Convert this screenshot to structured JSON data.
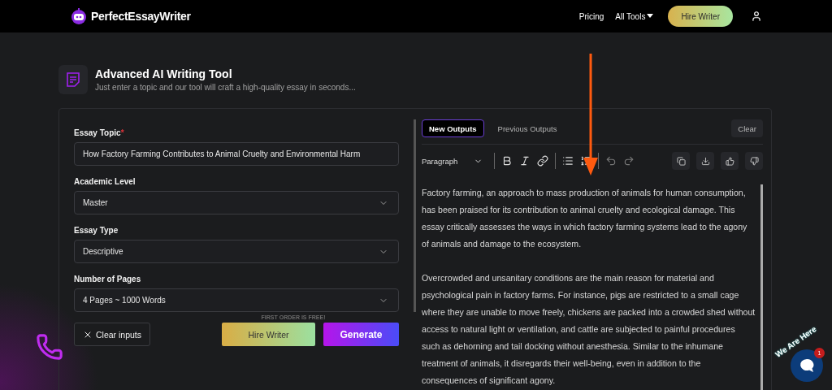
{
  "header": {
    "logo_text": "PerfectEssayWriter",
    "nav": [
      {
        "label": "Pricing",
        "kind": "link"
      },
      {
        "label": "All Tools",
        "kind": "dropdown"
      }
    ],
    "hire_button": "Hire Writer"
  },
  "tool": {
    "title": "Advanced AI Writing Tool",
    "subtitle": "Just enter a topic and our tool will craft a high-quality essay in seconds..."
  },
  "form": {
    "required_marker": "*",
    "fields": [
      {
        "label": "Essay Topic",
        "required": true,
        "kind": "text",
        "value": "How Factory Farming Contributes to Animal Cruelty and Environmental Harm"
      },
      {
        "label": "Academic Level",
        "required": false,
        "kind": "select",
        "value": "Master"
      },
      {
        "label": "Essay Type",
        "required": false,
        "kind": "select",
        "value": "Descriptive"
      },
      {
        "label": "Number of Pages",
        "required": false,
        "kind": "select",
        "value": "4 Pages ~ 1000 Words"
      }
    ],
    "note": "FIRST ORDER IS FREE!",
    "clear_button": "Clear inputs",
    "hire_button": "Hire Writer",
    "generate_button": "Generate"
  },
  "output": {
    "tabs": [
      {
        "label": "New Outputs",
        "selected": true
      },
      {
        "label": "Previous Outputs",
        "selected": false
      }
    ],
    "clear_button": "Clear",
    "block_format": "Paragraph",
    "paragraphs": [
      "Factory farming, an approach to mass production of animals for human consumption, has been praised for its contribution to animal cruelty and ecological damage. This essay critically assesses the ways in which factory farming systems lead to the agony of animals and damage to the ecosystem.",
      "Overcrowded and unsanitary conditions are the main reason for material and psychological pain in factory farms. For instance, pigs are restricted to a small cage where they are unable to move freely, chickens are packed into a crowded shed without access to natural light or ventilation, and cattle are subjected to painful procedures such as dehorning and tail docking without anesthesia. Similar to the inhumane treatment of animals, it disregards their well-being, even in addition to the consequences of significant agony."
    ]
  },
  "chat": {
    "tagline": "We Are Here",
    "badge": "1"
  }
}
